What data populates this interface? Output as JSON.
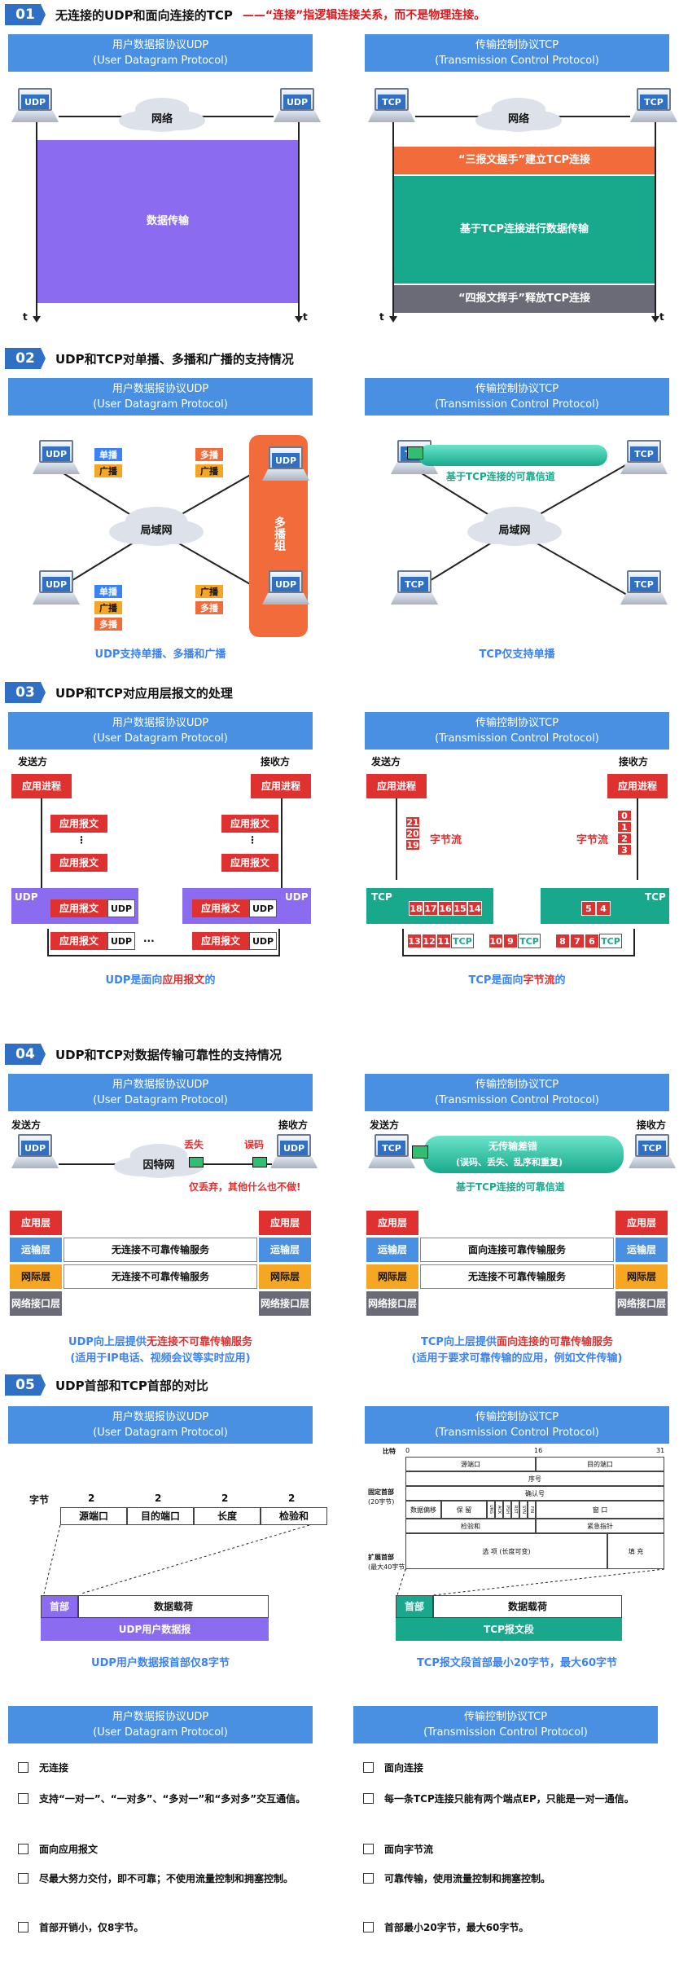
{
  "s1": {
    "num": "01",
    "title": "无连接的UDP和面向连接的TCP",
    "note": "——“连接”指逻辑连接关系，而不是物理连接。",
    "udp_net": "网络",
    "tcp_net": "网络",
    "data_transfer": "数据传输",
    "handshake": "“三报文握手”建立TCP连接",
    "tcp_transfer": "基于TCP连接进行数据传输",
    "wave": "“四报文挥手”释放TCP连接",
    "t": "t"
  },
  "banner": {
    "udp_cn": "用户数据报协议UDP",
    "udp_en": "(User Datagram Protocol)",
    "tcp_cn": "传输控制协议TCP",
    "tcp_en": "(Transmission Control Protocol)"
  },
  "tags": {
    "udp": "UDP",
    "tcp": "TCP"
  },
  "s2": {
    "num": "02",
    "title": "UDP和TCP对单播、多播和广播的支持情况",
    "unicast": "单播",
    "broadcast": "广播",
    "multicast": "多播",
    "lan": "局域网",
    "group": "多播组",
    "channel": "基于TCP连接的可靠信道",
    "cap_udp": "UDP支持单播、多播和广播",
    "cap_tcp": "TCP仅支持单播"
  },
  "s3": {
    "num": "03",
    "title": "UDP和TCP对应用层报文的处理",
    "sender": "发送方",
    "receiver": "接收方",
    "app": "应用进程",
    "msg": "应用报文",
    "dots": "⋮",
    "hdots": "···",
    "udp_hdr": "UDP",
    "stream": "字节流",
    "cap_udp_a": "UDP是面向",
    "cap_udp_b": "应用报文",
    "cap_udp_c": "的",
    "cap_tcp_a": "TCP是面向",
    "cap_tcp_b": "字节流",
    "cap_tcp_c": "的",
    "tcp_send_stack": [
      "21",
      "20",
      "19"
    ],
    "tcp_recv_stack": [
      "0",
      "1",
      "2",
      "3"
    ],
    "tcp_send_buf": [
      "18",
      "17",
      "16",
      "15",
      "14"
    ],
    "tcp_recv_buf": [
      "5",
      "4"
    ],
    "seg1": [
      "13",
      "12",
      "11"
    ],
    "seg2": [
      "10",
      "9"
    ],
    "seg3": [
      "8",
      "7",
      "6"
    ]
  },
  "s4": {
    "num": "04",
    "title": "UDP和TCP对数据传输可靠性的支持情况",
    "sender": "发送方",
    "receiver": "接收方",
    "unreliable_net": "因特网",
    "lost": "丢失",
    "err": "误码",
    "discard": "仅丢弃，其他什么也不做!",
    "tcp_tube": "无传输差错",
    "tcp_tube2": "(误码、丢失、乱序和重复)",
    "tcp_channel": "基于TCP连接的可靠信道",
    "layers": [
      "应用层",
      "运输层",
      "网际层",
      "网络接口层"
    ],
    "udp_svc": "无连接不可靠传输服务",
    "tcp_svc": "面向连接可靠传输服务",
    "ip_svc": "无连接不可靠传输服务",
    "cap_udp1_a": "UDP向上层提供",
    "cap_udp1_b": "无连接不可靠传输服务",
    "cap_udp2": "(适用于IP电话、视频会议等实时应用)",
    "cap_tcp1_a": "TCP向上层提供",
    "cap_tcp1_b": "面向连接的可靠传输服务",
    "cap_tcp2": "(适用于要求可靠传输的应用，例如文件传输)"
  },
  "s5": {
    "num": "05",
    "title": "UDP首部和TCP首部的对比",
    "bytes": "字节",
    "sizes": [
      "2",
      "2",
      "2",
      "2"
    ],
    "fields": [
      "源端口",
      "目的端口",
      "长度",
      "检验和"
    ],
    "header": "首部",
    "payload": "数据载荷",
    "udp_dgram": "UDP用户数据报",
    "tcp_seg": "TCP报文段",
    "cap_udp": "UDP用户数据报首部仅8字节",
    "cap_tcp": "TCP报文段首部最小20字节，最大60字节",
    "bits": "比特",
    "b0": "0",
    "b16": "16",
    "b31": "31",
    "fixed": "固定首部",
    "fixed2": "(20字节)",
    "ext": "扩展首部",
    "ext2": "(最大40字节)",
    "src": "源端口",
    "dst": "目的端口",
    "seq": "序号",
    "ack": "确认号",
    "off": "数据偏移",
    "rsv": "保 留",
    "flags": [
      "URG",
      "ACK",
      "PSH",
      "RST",
      "SYN",
      "FIN"
    ],
    "win": "窗 口",
    "cksum": "检验和",
    "urg": "紧急指针",
    "opt": "选 项 (长度可变)",
    "pad": "填 充"
  },
  "cmp_udp": [
    "无连接",
    "支持“一对一”、“一对多”、“多对一”和“多对多”交互通信。",
    "面向应用报文",
    "尽最大努力交付，即不可靠；不使用流量控制和拥塞控制。",
    "首部开销小，仅8字节。"
  ],
  "cmp_tcp": [
    "面向连接",
    "每一条TCP连接只能有两个端点EP，只能是一对一通信。",
    "面向字节流",
    "可靠传输，使用流量控制和拥塞控制。",
    "首部最小20字节，最大60字节。"
  ],
  "colors": {
    "blue": "#4a90e2",
    "purple": "#8b6cf0",
    "orange": "#f26b3a",
    "teal": "#18a98c",
    "gray": "#6b6b78",
    "red": "#e03131"
  }
}
